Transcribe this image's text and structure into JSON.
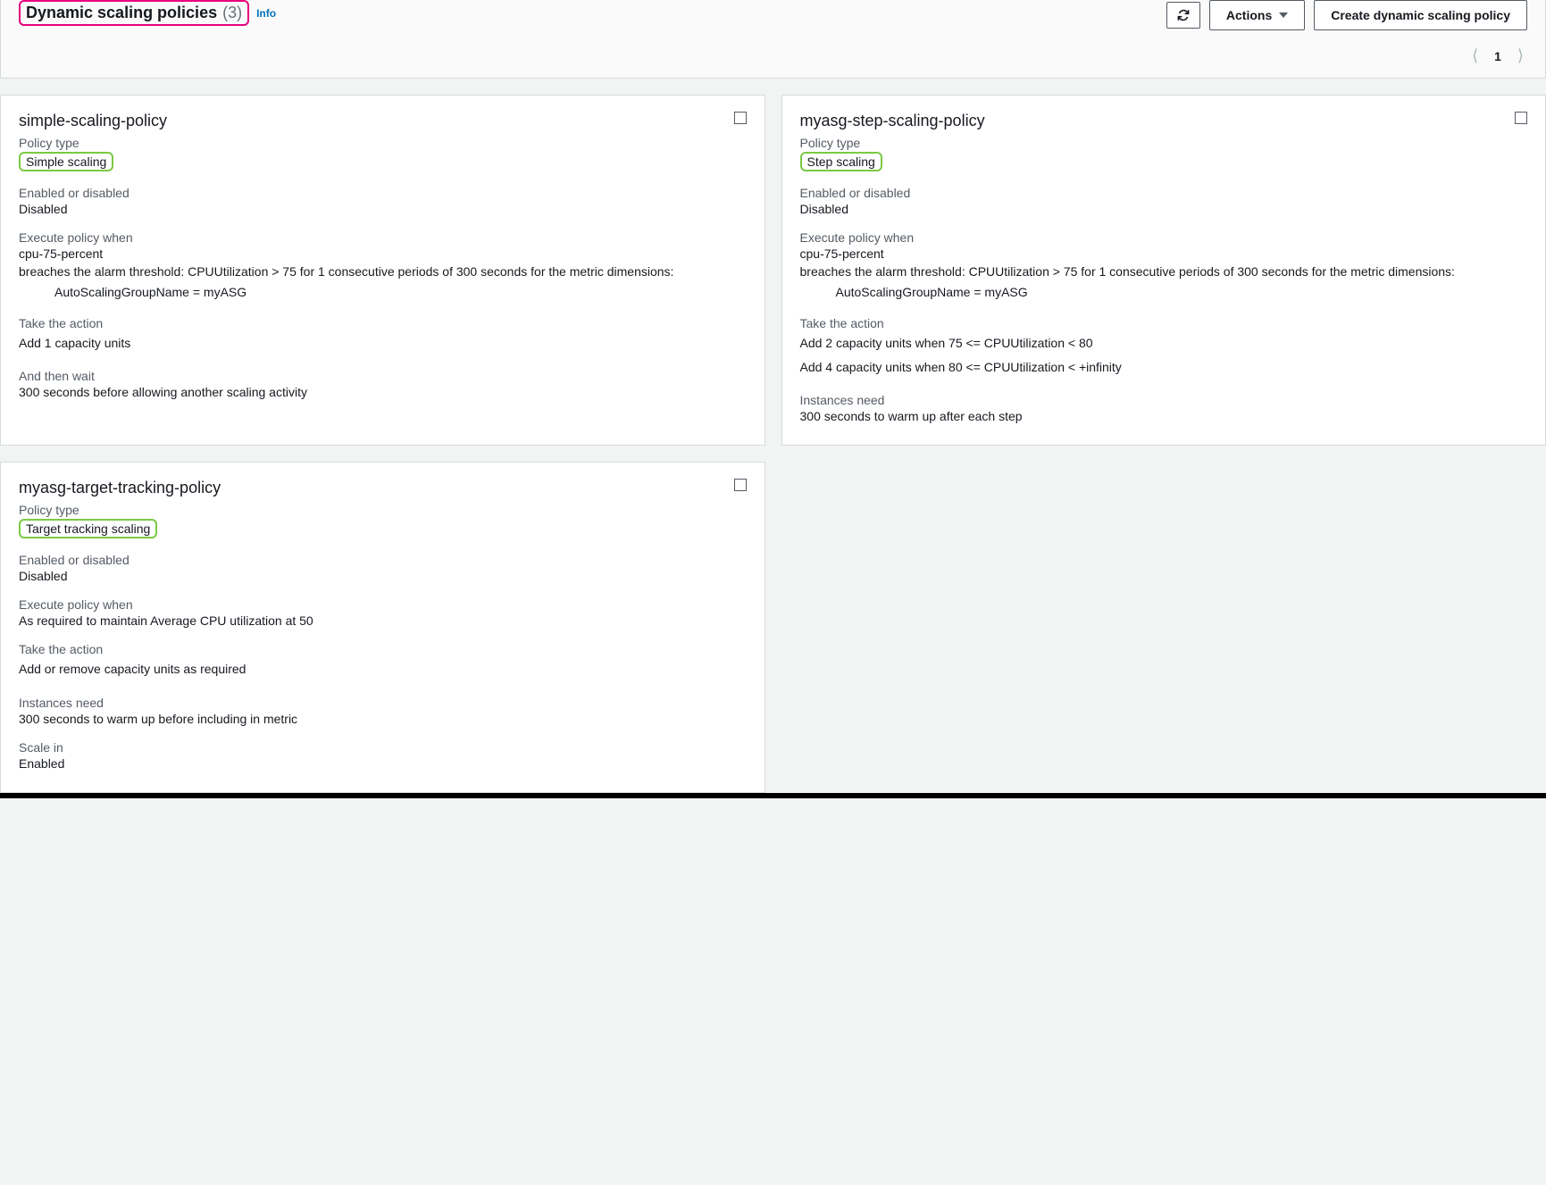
{
  "header": {
    "title": "Dynamic scaling policies",
    "count": "(3)",
    "info": "Info",
    "refresh_label": "Refresh",
    "actions_label": "Actions",
    "create_label": "Create dynamic scaling policy",
    "page": "1"
  },
  "labels": {
    "policy_type": "Policy type",
    "enabled": "Enabled or disabled",
    "execute_when": "Execute policy when",
    "take_action": "Take the action",
    "then_wait": "And then wait",
    "instances_need": "Instances need",
    "scale_in": "Scale in"
  },
  "cards": [
    {
      "name": "simple-scaling-policy",
      "type": "Simple scaling",
      "type_highlight": true,
      "enabled": "Disabled",
      "exec_title": "cpu-75-percent",
      "exec_desc": "breaches the alarm threshold: CPUUtilization > 75 for 1 consecutive periods of 300 seconds for the metric dimensions:",
      "exec_dim": "AutoScalingGroupName = myASG",
      "actions": [
        "Add 1 capacity units"
      ],
      "then_wait": "300 seconds before allowing another scaling activity"
    },
    {
      "name": "myasg-step-scaling-policy",
      "type": "Step scaling",
      "type_highlight": true,
      "enabled": "Disabled",
      "exec_title": "cpu-75-percent",
      "exec_desc": "breaches the alarm threshold: CPUUtilization > 75 for 1 consecutive periods of 300 seconds for the metric dimensions:",
      "exec_dim": "AutoScalingGroupName = myASG",
      "actions": [
        "Add 2 capacity units when 75 <= CPUUtilization < 80",
        "Add 4 capacity units when 80 <= CPUUtilization < +infinity"
      ],
      "instances_need": "300 seconds to warm up after each step"
    },
    {
      "name": "myasg-target-tracking-policy",
      "type": "Target tracking scaling",
      "type_highlight": true,
      "enabled": "Disabled",
      "exec_value": "As required to maintain Average CPU utilization at 50",
      "actions": [
        "Add or remove capacity units as required"
      ],
      "instances_need": "300 seconds to warm up before including in metric",
      "scale_in": "Enabled"
    }
  ]
}
